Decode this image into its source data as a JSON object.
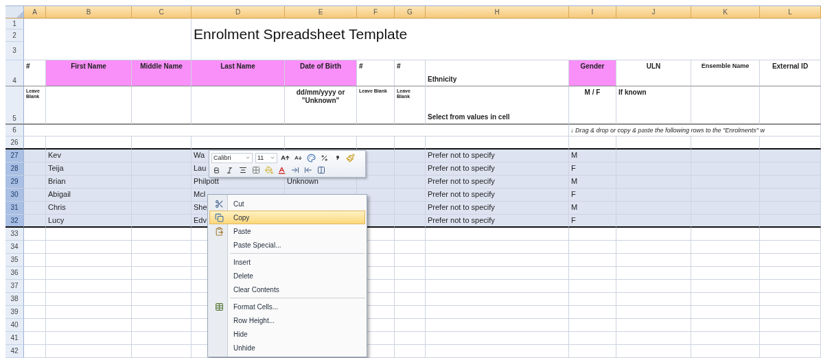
{
  "sheet": {
    "columns": [
      "A",
      "B",
      "C",
      "D",
      "E",
      "F",
      "G",
      "H",
      "I",
      "J",
      "K",
      "L"
    ],
    "title_block": {
      "row_numbers": [
        "1",
        "2",
        "3"
      ],
      "title": "Enrolment Spreadsheet Template"
    },
    "header_row": {
      "number": "4",
      "cells": [
        {
          "text": "#",
          "highlighted": false
        },
        {
          "text": "First Name",
          "highlighted": true
        },
        {
          "text": "Middle Name",
          "highlighted": true
        },
        {
          "text": "Last Name",
          "highlighted": true
        },
        {
          "text": "Date of Birth",
          "highlighted": true
        },
        {
          "text": "#",
          "highlighted": false
        },
        {
          "text": "#",
          "highlighted": false
        },
        {
          "text": "Ethnicity",
          "highlighted": false
        },
        {
          "text": "Gender",
          "highlighted": true
        },
        {
          "text": "ULN",
          "highlighted": false
        },
        {
          "text": "Ensemble Name",
          "highlighted": false
        },
        {
          "text": "External ID",
          "highlighted": false
        }
      ]
    },
    "notes_row": {
      "number": "5",
      "cells": {
        "A": "Leave Blank",
        "E": "dd/mm/yyyy or \"Unknown\"",
        "F": "Leave Blank",
        "G": "Leave Blank",
        "H": "Select from values in cell",
        "I": "M / F",
        "J": "If known"
      }
    },
    "instruction_row": {
      "number": "6",
      "text": "↓ Drag & drop or copy & paste the following rows to the  \"Enrolments\" w"
    },
    "rows": [
      {
        "number": "26",
        "selected": false,
        "cells": {}
      },
      {
        "number": "27",
        "selected": true,
        "cells": {
          "B": "Kev",
          "D": "Wa",
          "H": "Prefer not to specify",
          "I": "M"
        }
      },
      {
        "number": "28",
        "selected": true,
        "cells": {
          "B": "Teija",
          "D": "Lau",
          "H": "Prefer not to specify",
          "I": "F"
        }
      },
      {
        "number": "29",
        "selected": true,
        "cells": {
          "B": "Brian",
          "D": "Philpott",
          "E": "Unknown",
          "H": "Prefer not to specify",
          "I": "M"
        }
      },
      {
        "number": "30",
        "selected": true,
        "cells": {
          "B": "Abigail",
          "D": "Mcl",
          "H": "Prefer not to specify",
          "I": "F"
        }
      },
      {
        "number": "31",
        "selected": true,
        "cells": {
          "B": "Chris",
          "D": "She",
          "H": "Prefer not to specify",
          "I": "M"
        }
      },
      {
        "number": "32",
        "selected": true,
        "cells": {
          "B": "Lucy",
          "D": "Edv",
          "H": "Prefer not to specify",
          "I": "F"
        }
      },
      {
        "number": "33",
        "selected": false,
        "cells": {}
      },
      {
        "number": "34",
        "selected": false,
        "cells": {}
      },
      {
        "number": "35",
        "selected": false,
        "cells": {}
      },
      {
        "number": "36",
        "selected": false,
        "cells": {}
      },
      {
        "number": "37",
        "selected": false,
        "cells": {}
      },
      {
        "number": "38",
        "selected": false,
        "cells": {}
      },
      {
        "number": "39",
        "selected": false,
        "cells": {}
      },
      {
        "number": "40",
        "selected": false,
        "cells": {}
      },
      {
        "number": "41",
        "selected": false,
        "cells": {}
      },
      {
        "number": "42",
        "selected": false,
        "cells": {}
      }
    ]
  },
  "mini_toolbar": {
    "font": "Calibri",
    "size": "11"
  },
  "context_menu": {
    "groups": [
      [
        {
          "label": "Cut",
          "selected": false
        },
        {
          "label": "Copy",
          "selected": true
        },
        {
          "label": "Paste",
          "selected": false
        },
        {
          "label": "Paste Special...",
          "selected": false
        }
      ],
      [
        {
          "label": "Insert",
          "selected": false
        },
        {
          "label": "Delete",
          "selected": false
        },
        {
          "label": "Clear Contents",
          "selected": false
        }
      ],
      [
        {
          "label": "Format Cells...",
          "selected": false
        },
        {
          "label": "Row Height...",
          "selected": false
        },
        {
          "label": "Hide",
          "selected": false
        },
        {
          "label": "Unhide",
          "selected": false
        }
      ]
    ]
  }
}
